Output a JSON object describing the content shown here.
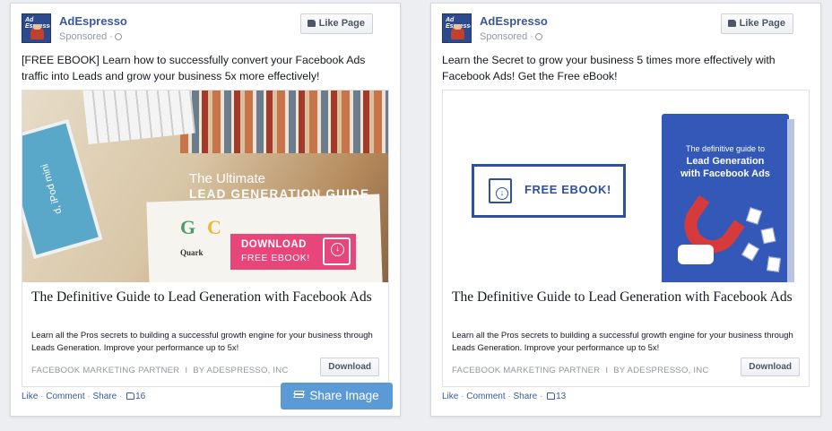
{
  "cards": [
    {
      "page_name": "AdEspresso",
      "sponsored": "Sponsored ·",
      "avatar_text": "Ad\nEspresso",
      "like_page": "Like Page",
      "message": "[FREE EBOOK] Learn how to successfully convert your Facebook Ads traffic into Leads and grow your business 5x more effectively!",
      "image": {
        "line1": "The Ultimate",
        "line2": "LEAD GENERATION GUIDE",
        "device_text": "d, iPod mini",
        "brand1": "Quark",
        "cta_line1": "DOWNLOAD",
        "cta_line2": "FREE EBOOK!"
      },
      "title": "The Definitive Guide to Lead Generation with Facebook Ads",
      "description": "Learn all the Pros secrets to building a successful growth engine for your business through Leads Generation. Improve your performance up to 5x!",
      "domain_left": "FACEBOOK MARKETING PARTNER",
      "domain_sep": "I",
      "domain_right": "BY ADESPRESSO, INC",
      "cta_button": "Download",
      "footer": {
        "like": "Like",
        "comment": "Comment",
        "share": "Share",
        "count": "16"
      }
    },
    {
      "page_name": "AdEspresso",
      "sponsored": "Sponsored ·",
      "avatar_text": "Ad\nEspresso",
      "like_page": "Like Page",
      "message": "Learn the Secret to grow your business 5 times more effectively with Facebook Ads! Get the Free eBook!",
      "image": {
        "box_text": "FREE EBOOK!",
        "book_line1": "The definitive guide to",
        "book_line2": "Lead Generation",
        "book_line3": "with Facebook Ads"
      },
      "title": "The Definitive Guide to Lead Generation with Facebook Ads",
      "description": "Learn all the Pros secrets to building a successful growth engine for your business through Leads Generation. Improve your performance up to 5x!",
      "domain_left": "FACEBOOK MARKETING PARTNER",
      "domain_sep": "I",
      "domain_right": "BY ADESPRESSO, INC",
      "cta_button": "Download",
      "footer": {
        "like": "Like",
        "comment": "Comment",
        "share": "Share",
        "count": "13"
      }
    }
  ],
  "share_image_button": "Share Image",
  "colors": {
    "facebook_blue": "#3b5998",
    "share_button": "#5b9bd5",
    "cta_pink": "#e8457a",
    "ebook_blue": "#2f4fa0"
  }
}
